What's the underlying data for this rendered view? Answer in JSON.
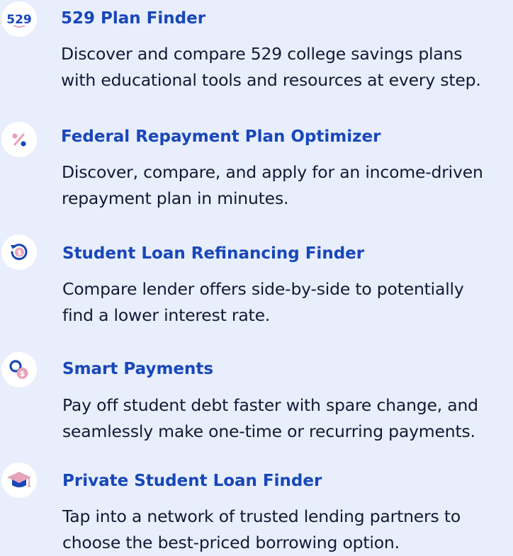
{
  "colors": {
    "background": "#e8eefc",
    "title": "#1847b8",
    "body_text": "#121a33",
    "icon_blue": "#1847b8",
    "icon_pink": "#e7a3b8"
  },
  "features": [
    {
      "icon": "529-badge-icon",
      "icon_text": "529",
      "title": "529 Plan Finder",
      "description": [
        "Discover and compare 529 college savings plans",
        "with educational tools and resources at every step."
      ]
    },
    {
      "icon": "percent-icon",
      "title": "Federal Repayment Plan Optimizer",
      "description": [
        "Discover, compare, and apply for an income-driven",
        "repayment plan in minutes."
      ]
    },
    {
      "icon": "refinance-dollar-icon",
      "title": "Student Loan Refinancing Finder",
      "description": [
        "Compare lender offers side-by-side to potentially",
        "find a lower interest rate."
      ]
    },
    {
      "icon": "search-coin-icon",
      "title": "Smart Payments",
      "description": [
        "Pay off student debt faster with spare change, and",
        "seamlessly make one-time or recurring payments."
      ]
    },
    {
      "icon": "graduation-cap-icon",
      "title": "Private Student Loan Finder",
      "description": [
        "Tap into a network of trusted lending partners to",
        "choose the best-priced borrowing option."
      ]
    }
  ]
}
